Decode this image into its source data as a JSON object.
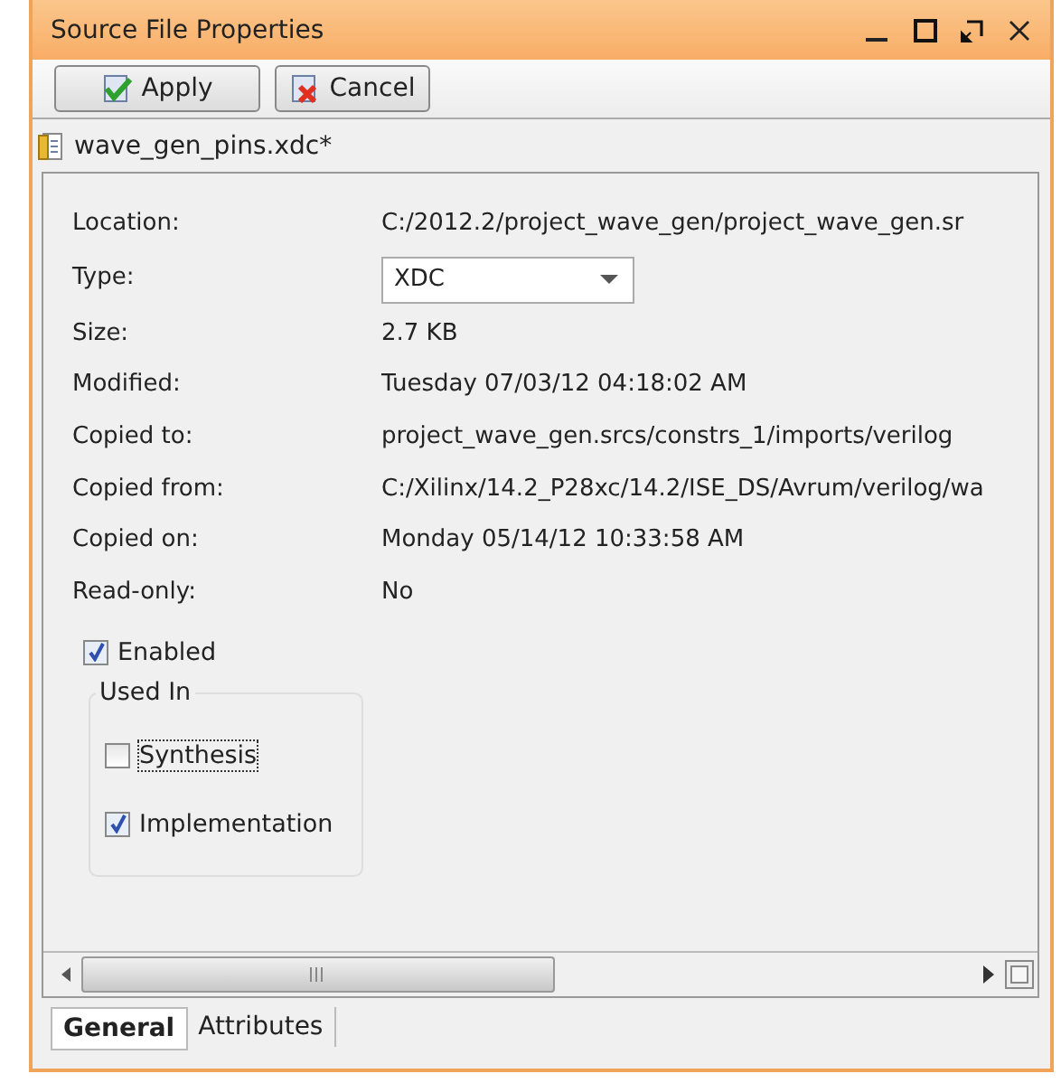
{
  "window": {
    "title": "Source File Properties"
  },
  "toolbar": [
    {
      "kind": "apply",
      "label": "Apply"
    },
    {
      "kind": "cancel",
      "label": "Cancel"
    }
  ],
  "file": {
    "name": "wave_gen_pins.xdc*"
  },
  "properties": [
    {
      "kind": "text",
      "label": "Location:",
      "value": "C:/2012.2/project_wave_gen/project_wave_gen.sr"
    },
    {
      "kind": "dropdown",
      "label": "Type:",
      "value": "XDC"
    },
    {
      "kind": "text",
      "label": "Size:",
      "value": "2.7 KB"
    },
    {
      "kind": "text",
      "label": "Modified:",
      "value": "Tuesday 07/03/12 04:18:02 AM"
    },
    {
      "kind": "text",
      "label": "Copied to:",
      "value": "project_wave_gen.srcs/constrs_1/imports/verilog"
    },
    {
      "kind": "text",
      "label": "Copied from:",
      "value": "C:/Xilinx/14.2_P28xc/14.2/ISE_DS/Avrum/verilog/wa"
    },
    {
      "kind": "text",
      "label": "Copied on:",
      "value": "Monday 05/14/12 10:33:58 AM"
    },
    {
      "kind": "text",
      "label": "Read-only:",
      "value": "No"
    }
  ],
  "enabled": {
    "label": "Enabled",
    "checked": true
  },
  "used_in": {
    "title": "Used In",
    "options": [
      {
        "label": "Synthesis",
        "checked": false,
        "focused": true
      },
      {
        "label": "Implementation",
        "checked": true,
        "focused": false
      }
    ]
  },
  "tabs": [
    {
      "label": "General",
      "selected": true
    },
    {
      "label": "Attributes",
      "selected": false
    }
  ]
}
